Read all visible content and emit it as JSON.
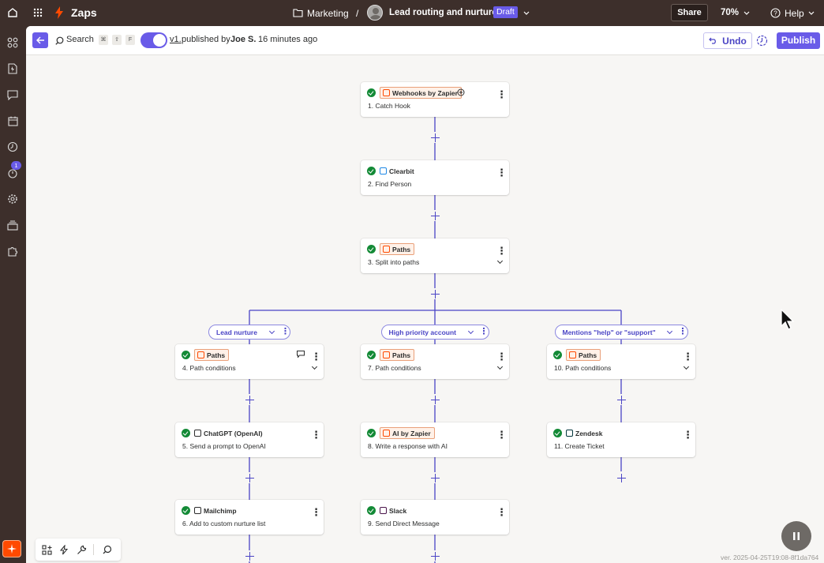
{
  "topbar": {
    "app_name": "Zaps",
    "breadcrumb_folder": "Marketing",
    "breadcrumb_sep": "/",
    "zap_name": "Lead routing and nurture",
    "status_badge": "Draft",
    "share_label": "Share",
    "zoom_label": "70%",
    "help_label": "Help"
  },
  "leftrail": {
    "notification_count": "1",
    "icons": [
      "apps-icon",
      "zap-file-icon",
      "chat-icon",
      "calendar-icon",
      "history-icon",
      "notification-icon",
      "settings-icon",
      "stack-icon",
      "puzzle-icon"
    ]
  },
  "toolbar": {
    "search_label": "Search",
    "shortcut_keys": [
      "⌘",
      "⇧",
      "F"
    ],
    "version_label": "v1.",
    "published_text": "published by",
    "publisher": "Joe S.",
    "published_time": "16 minutes ago",
    "undo_label": "Undo",
    "publish_label": "Publish"
  },
  "steps": [
    {
      "app": "Webhooks by Zapier",
      "title": "1. Catch Hook",
      "tagged": true,
      "color": "#ff4a00"
    },
    {
      "app": "Clearbit",
      "title": "2. Find Person",
      "tagged": false,
      "color": "#1e88e5"
    },
    {
      "app": "Paths",
      "title": "3. Split into paths",
      "tagged": true,
      "color": "#ff4a00"
    },
    {
      "app": "Paths",
      "title": "4. Path conditions",
      "tagged": true,
      "color": "#ff4a00"
    },
    {
      "app": "ChatGPT (OpenAI)",
      "title": "5. Send a prompt to OpenAI",
      "tagged": false,
      "color": "#2d2e2e"
    },
    {
      "app": "Mailchimp",
      "title": "6. Add to custom nurture list",
      "tagged": false,
      "color": "#2d2e2e"
    },
    {
      "app": "Paths",
      "title": "7. Path conditions",
      "tagged": true,
      "color": "#ff4a00"
    },
    {
      "app": "AI by Zapier",
      "title": "8. Write a response with AI",
      "tagged": true,
      "color": "#ff4a00"
    },
    {
      "app": "Slack",
      "title": "9. Send Direct Message",
      "tagged": false,
      "color": "#4a154b"
    },
    {
      "app": "Paths",
      "title": "10. Path conditions",
      "tagged": true,
      "color": "#ff4a00"
    },
    {
      "app": "Zendesk",
      "title": "11. Create Ticket",
      "tagged": false,
      "color": "#03363d"
    }
  ],
  "paths": [
    {
      "label": "Lead nurture"
    },
    {
      "label": "High priority account"
    },
    {
      "label": "Mentions \"help\" or \"support\""
    }
  ],
  "footer": {
    "version_text": "ver. 2025-04-25T19:08-8f1da764"
  },
  "colors": {
    "accent": "#695be8",
    "brand_orange": "#ff4a00",
    "connector": "#4a44c5",
    "success": "#138a36"
  }
}
